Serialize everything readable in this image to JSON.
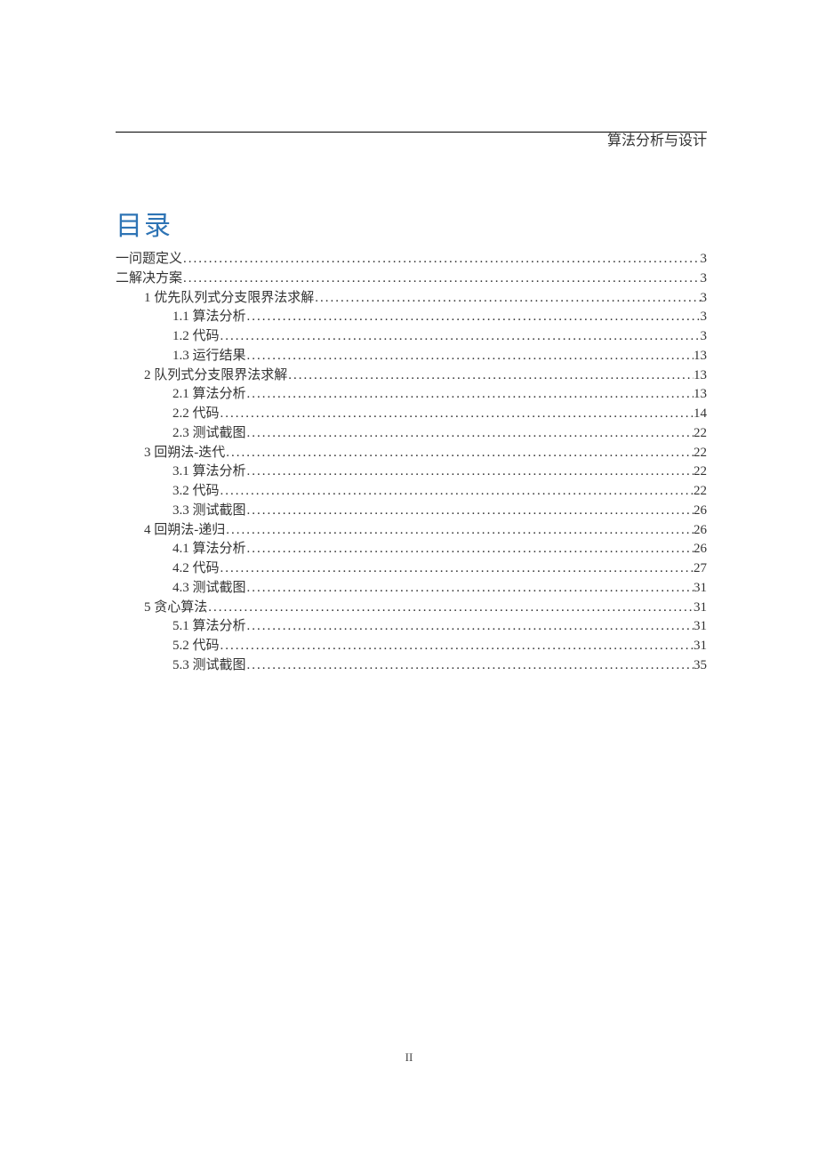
{
  "header": {
    "title": "算法分析与设计"
  },
  "toc_title": "目录",
  "page_number": "II",
  "toc": [
    {
      "level": 0,
      "label": "一问题定义",
      "page": "3"
    },
    {
      "level": 0,
      "label": "二解决方案",
      "page": "3"
    },
    {
      "level": 1,
      "label": "1 优先队列式分支限界法求解",
      "page": "3"
    },
    {
      "level": 2,
      "label": "1.1 算法分析",
      "page": "3"
    },
    {
      "level": 2,
      "label": "1.2 代码",
      "page": "3"
    },
    {
      "level": 2,
      "label": "1.3 运行结果",
      "page": "13"
    },
    {
      "level": 1,
      "label": "2 队列式分支限界法求解",
      "page": "13"
    },
    {
      "level": 2,
      "label": "2.1 算法分析",
      "page": "13"
    },
    {
      "level": 2,
      "label": "2.2 代码",
      "page": "14"
    },
    {
      "level": 2,
      "label": "2.3 测试截图",
      "page": "22"
    },
    {
      "level": 1,
      "label": "3 回朔法-迭代",
      "page": "22"
    },
    {
      "level": 2,
      "label": "3.1 算法分析",
      "page": "22"
    },
    {
      "level": 2,
      "label": "3.2 代码",
      "page": "22"
    },
    {
      "level": 2,
      "label": "3.3 测试截图",
      "page": "26"
    },
    {
      "level": 1,
      "label": "4 回朔法-递归",
      "page": "26"
    },
    {
      "level": 2,
      "label": "4.1 算法分析",
      "page": "26"
    },
    {
      "level": 2,
      "label": "4.2 代码",
      "page": "27"
    },
    {
      "level": 2,
      "label": "4.3 测试截图",
      "page": "31"
    },
    {
      "level": 1,
      "label": "5 贪心算法",
      "page": "31"
    },
    {
      "level": 2,
      "label": "5.1 算法分析",
      "page": "31"
    },
    {
      "level": 2,
      "label": "5.2 代码",
      "page": "31"
    },
    {
      "level": 2,
      "label": "5.3 测试截图",
      "page": "35"
    }
  ]
}
